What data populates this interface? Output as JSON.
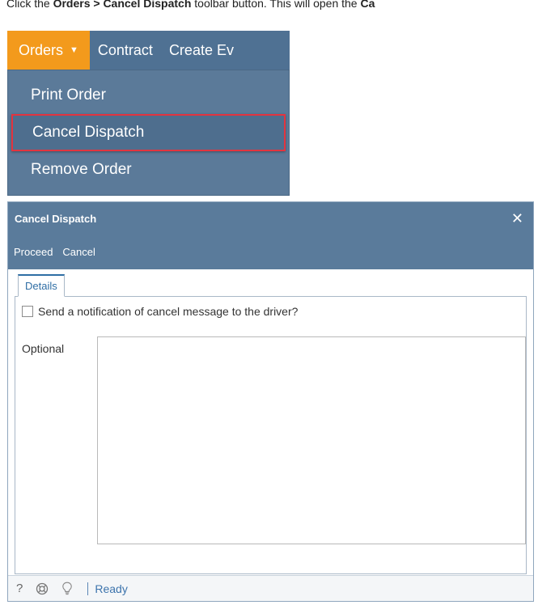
{
  "instruction": {
    "prefix": "Click the ",
    "bold1": "Orders > Cancel Dispatch",
    "middle": " toolbar button. This will open the ",
    "bold2": "Ca"
  },
  "toolbar": {
    "orders_label": "Orders",
    "contract_label": "Contract",
    "create_ev_label": "Create Ev"
  },
  "menu": {
    "items": [
      {
        "label": "Print Order"
      },
      {
        "label": "Cancel Dispatch"
      },
      {
        "label": "Remove Order"
      }
    ]
  },
  "dialog": {
    "title": "Cancel Dispatch",
    "close": "✕",
    "actions": {
      "proceed": "Proceed",
      "cancel": "Cancel"
    },
    "tab": "Details",
    "checkbox_label": "Send a notification of cancel message to the driver?",
    "optional_label": "Optional",
    "optional_value": ""
  },
  "statusbar": {
    "help": "?",
    "status": "Ready"
  },
  "colors": {
    "toolbar_bg": "#4f7193",
    "orders_accent": "#f39a1c",
    "highlight_border": "#e3343f",
    "dialog_header": "#5a7b9b",
    "tab_accent": "#2f6ea5"
  }
}
